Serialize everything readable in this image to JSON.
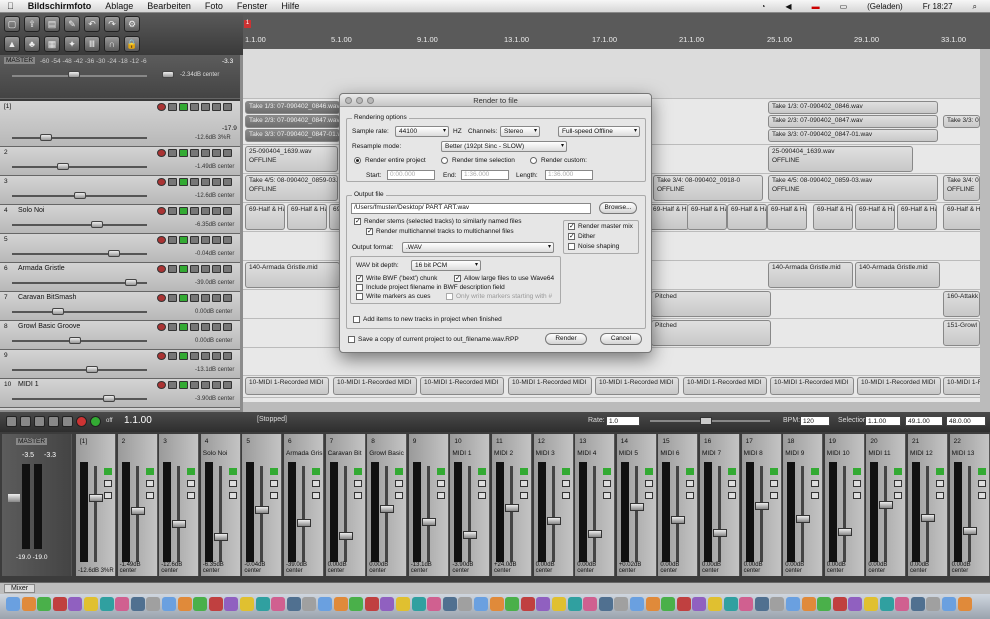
{
  "menubar": {
    "app": "Bildschirmfoto",
    "items": [
      "Ablage",
      "Bearbeiten",
      "Foto",
      "Fenster",
      "Hilfe"
    ],
    "battery": "(Geladen)",
    "clock": "Fr 18:27"
  },
  "ruler": {
    "marker": "1",
    "labels": [
      "1.1.00",
      "5.1.00",
      "9.1.00",
      "13.1.00",
      "17.1.00",
      "21.1.00",
      "25.1.00",
      "29.1.00",
      "33.1.00"
    ]
  },
  "master": {
    "label": "MASTER",
    "scale": "-60 -54 -48 -42 -36 -30 -24 -18 -12 -6",
    "peak": "-3.3",
    "vol": "-2.34dB center"
  },
  "tracks": [
    {
      "num": "[1]",
      "name": "",
      "vol": "-12.6dB 3%R",
      "peak": "-17.9"
    },
    {
      "num": "2",
      "name": "",
      "vol": "-1.49dB center"
    },
    {
      "num": "3",
      "name": "",
      "vol": "-12.6dB center"
    },
    {
      "num": "4",
      "name": "Solo Noi",
      "vol": "-6.35dB center"
    },
    {
      "num": "5",
      "name": "",
      "vol": "-0.04dB center"
    },
    {
      "num": "6",
      "name": "Armada Gristle",
      "vol": "-39.0dB center"
    },
    {
      "num": "7",
      "name": "Caravan BitSmash",
      "vol": "0.00dB center"
    },
    {
      "num": "8",
      "name": "Growl Basic Groove",
      "vol": "0.00dB center"
    },
    {
      "num": "9",
      "name": "",
      "vol": "-13.1dB center"
    },
    {
      "num": "10",
      "name": "MIDI 1",
      "vol": "-3.90dB center"
    },
    {
      "num": "11",
      "name": "MIDI 2",
      "vol": ""
    }
  ],
  "items": {
    "take1": "Take 1/3: 07-090402_0846.wav",
    "take2": "Take 2/3: 07-090402_0847.wav",
    "take3": "Take 3/3: 07-090402_0847-01.wav",
    "take1b": "Take 1/3: 07-090402_0846.wav",
    "take2b": "Take 2/3: 07-090402_0847.wav",
    "take3b": "Take 3/3: 07-090402_0847-01.wav",
    "take3c": "Take 3/3: 07-",
    "off1": "25-090404_1639.wav",
    "off2": "25-090404_1639.wav",
    "offline": "OFFLINE",
    "take45a": "Take 4/5: 08-090402_0859-03.wav",
    "take34a": "Take 3/4: 08-090402_0918-0",
    "take45b": "Take 4/5: 08-090402_0859-03.wav",
    "take34b": "Take 3/4: 08-",
    "half": "69-Half & Ha",
    "armada1": "140-Armada Gristle.mid",
    "armada2": "140-Armada Gristle.mid",
    "armada3": "140-Armada Gristle.mid",
    "attack": "160-Attakk",
    "growl": "151-Growl",
    "recmidi": "10-MIDI 1-Recorded MIDI",
    "pitched": "Pitched"
  },
  "transport": {
    "time": "1.1.00",
    "status": "[Stopped]",
    "rate_label": "Rate:",
    "rate": "1.0",
    "bpm_label": "BPM:",
    "bpm": "120",
    "sel_label": "Selection:",
    "sel_start": "1.1.00",
    "sel_end": "49.1.00",
    "sel_len": "48.0.00",
    "off": "off"
  },
  "mixer": {
    "tab": "Mixer",
    "master_label": "MASTER",
    "master_peaks": [
      "-3.5",
      "-3.3"
    ],
    "master_vol": "-19.0 -19.0",
    "strips": [
      {
        "num": "[1]",
        "name": "",
        "db": "-12.6dB 3%R"
      },
      {
        "num": "2",
        "name": "",
        "db": "-1.49dB center"
      },
      {
        "num": "3",
        "name": "",
        "db": "-12.6dB center"
      },
      {
        "num": "4",
        "name": "Solo Noi",
        "db": "-6.35dB center"
      },
      {
        "num": "5",
        "name": "",
        "db": "-0.04dB center"
      },
      {
        "num": "6",
        "name": "Armada Gris",
        "db": "-39.0dB center"
      },
      {
        "num": "7",
        "name": "Caravan Bit",
        "db": "0.00dB center"
      },
      {
        "num": "8",
        "name": "Growl Basic",
        "db": "0.00dB center"
      },
      {
        "num": "9",
        "name": "",
        "db": "-13.1dB center"
      },
      {
        "num": "10",
        "name": "MIDI 1",
        "db": "-3.90dB center"
      },
      {
        "num": "11",
        "name": "MIDI 2",
        "db": "+24.0dB center"
      },
      {
        "num": "12",
        "name": "MIDI 3",
        "db": "0.00dB center"
      },
      {
        "num": "13",
        "name": "MIDI 4",
        "db": "0.00dB center"
      },
      {
        "num": "14",
        "name": "MIDI 5",
        "db": "+0.02dB center"
      },
      {
        "num": "15",
        "name": "MIDI 6",
        "db": "0.00dB center"
      },
      {
        "num": "16",
        "name": "MIDI 7",
        "db": "0.00dB center"
      },
      {
        "num": "17",
        "name": "MIDI 8",
        "db": "0.00dB center"
      },
      {
        "num": "18",
        "name": "MIDI 9",
        "db": "0.00dB center"
      },
      {
        "num": "19",
        "name": "MIDI 10",
        "db": "0.00dB center"
      },
      {
        "num": "20",
        "name": "MIDI 11",
        "db": "0.00dB center"
      },
      {
        "num": "21",
        "name": "MIDI 12",
        "db": "0.00dB center"
      },
      {
        "num": "22",
        "name": "MIDI 13",
        "db": "0.00dB center"
      }
    ]
  },
  "dialog": {
    "title": "Render to file",
    "options_group": "Rendering options",
    "sample_rate_label": "Sample rate:",
    "sample_rate": "44100",
    "hz": "HZ",
    "channels_label": "Channels:",
    "channels": "Stereo",
    "mode": "Full-speed Offline",
    "resample_label": "Resample mode:",
    "resample": "Better (192pt Sinc - SLOW)",
    "radio_entire": "Render entire project",
    "radio_time": "Render time selection",
    "radio_custom": "Render custom:",
    "start_label": "Start:",
    "start": "0:00.000",
    "end_label": "End:",
    "end": "1:36.000",
    "length_label": "Length:",
    "length": "1:36.000",
    "output_group": "Output file",
    "path": "/Users/fmuster/Desktop/ PART ART.wav",
    "browse": "Browse...",
    "stems": "Render stems (selected tracks) to similarly named files",
    "multichannel": "Render multichannel tracks to multichannel files",
    "render_master": "Render master mix",
    "dither": "Dither",
    "noise": "Noise shaping",
    "format_label": "Output format:",
    "format": ".WAV",
    "bitdepth_label": "WAV bit depth:",
    "bitdepth": "16 bit PCM",
    "bwf": "Write BWF ('bext') chunk",
    "large": "Allow large files to use Wave64",
    "include_name": "Include project filename in BWF description field",
    "markers": "Write markers as cues",
    "only_markers": "Only write markers starting with #",
    "add_items": "Add items to new tracks in project when finished",
    "save_copy": "Save a copy of current project to out_filename.wav.RPP",
    "render": "Render",
    "cancel": "Cancel"
  }
}
